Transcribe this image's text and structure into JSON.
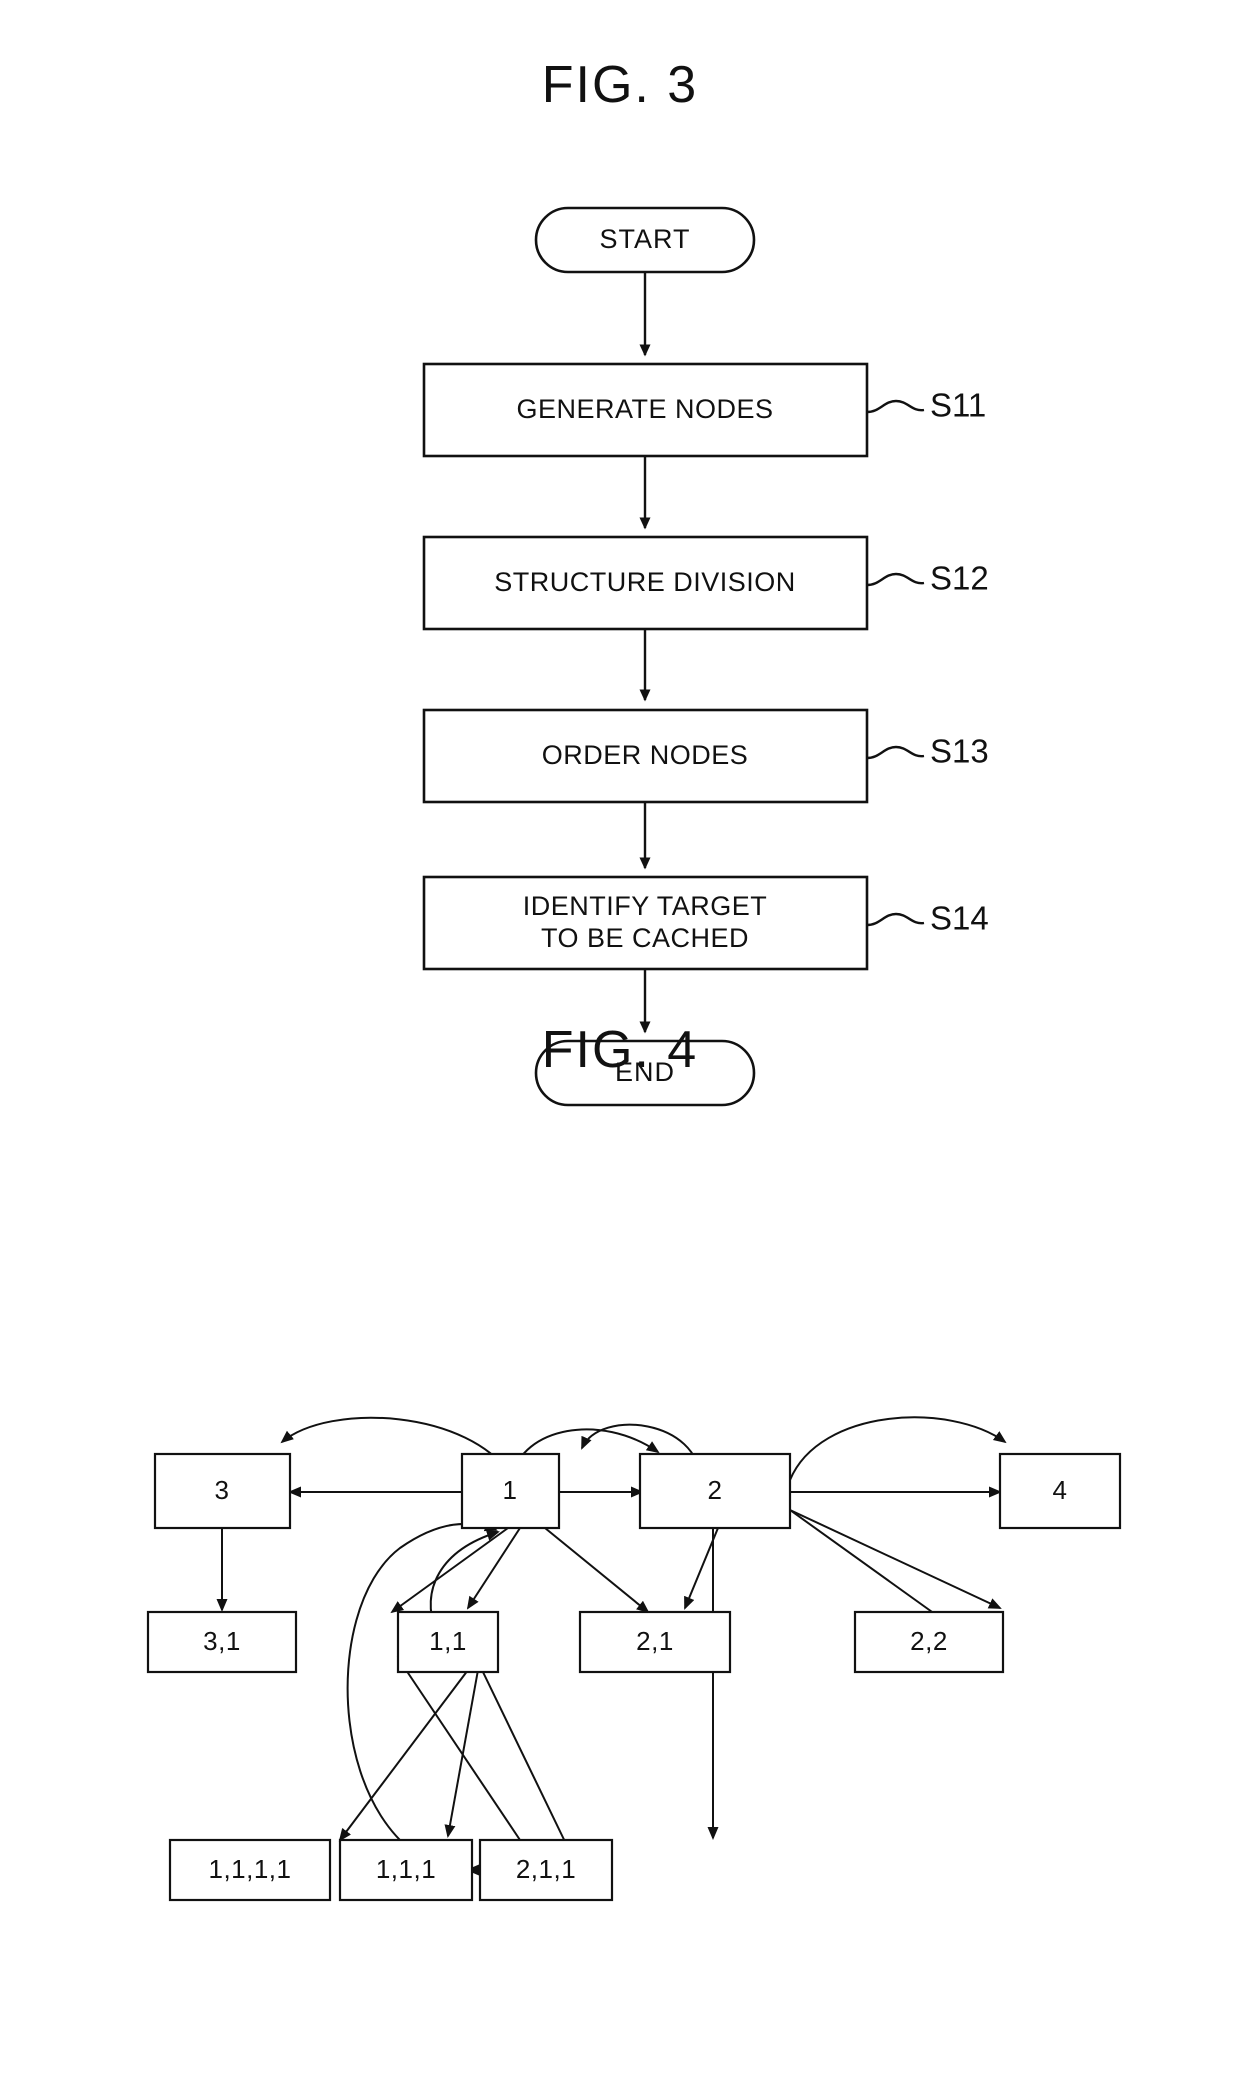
{
  "figures": [
    {
      "title": "FIG. 3",
      "type": "flowchart",
      "nodes": [
        {
          "id": "start",
          "shape": "terminal",
          "label": "START"
        },
        {
          "id": "s11",
          "shape": "process",
          "label": "GENERATE NODES",
          "step": "S11"
        },
        {
          "id": "s12",
          "shape": "process",
          "label": "STRUCTURE DIVISION",
          "step": "S12"
        },
        {
          "id": "s13",
          "shape": "process",
          "label": "ORDER NODES",
          "step": "S13"
        },
        {
          "id": "s14",
          "shape": "process",
          "label_line1": "IDENTIFY TARGET",
          "label_line2": "TO BE CACHED",
          "step": "S14"
        },
        {
          "id": "end",
          "shape": "terminal",
          "label": "END"
        }
      ]
    },
    {
      "title": "FIG. 4",
      "type": "node-graph",
      "nodes": [
        {
          "id": "n3",
          "label": "3"
        },
        {
          "id": "n1",
          "label": "1"
        },
        {
          "id": "n2",
          "label": "2"
        },
        {
          "id": "n4",
          "label": "4"
        },
        {
          "id": "n31",
          "label": "3,1"
        },
        {
          "id": "n11",
          "label": "1,1"
        },
        {
          "id": "n21",
          "label": "2,1"
        },
        {
          "id": "n22",
          "label": "2,2"
        },
        {
          "id": "n1111",
          "label": "1,1,1,1"
        },
        {
          "id": "n111",
          "label": "1,1,1"
        },
        {
          "id": "n211",
          "label": "2,1,1"
        }
      ],
      "edges": [
        {
          "from": "n1",
          "to": "n3",
          "style": "curve"
        },
        {
          "from": "n1",
          "to": "n3",
          "style": "straight"
        },
        {
          "from": "n1",
          "to": "n2",
          "style": "straight"
        },
        {
          "from": "n1",
          "to": "n2",
          "style": "curve"
        },
        {
          "from": "n2",
          "to": "n2",
          "style": "curve"
        },
        {
          "from": "n2",
          "to": "n4",
          "style": "straight"
        },
        {
          "from": "n2",
          "to": "n4",
          "style": "curve"
        },
        {
          "from": "n3",
          "to": "n31",
          "style": "straight"
        },
        {
          "from": "n1",
          "to": "n31",
          "style": "straight"
        },
        {
          "from": "n1",
          "to": "n11",
          "style": "straight"
        },
        {
          "from": "n1",
          "to": "n21",
          "style": "straight"
        },
        {
          "from": "n2",
          "to": "n21",
          "style": "straight"
        },
        {
          "from": "n2",
          "to": "n22",
          "style": "straight"
        },
        {
          "from": "n2",
          "to": "n211",
          "style": "straight"
        },
        {
          "from": "n11",
          "to": "n1111",
          "style": "straight"
        },
        {
          "from": "n11",
          "to": "n111",
          "style": "straight"
        },
        {
          "from": "n11",
          "to": "n211",
          "style": "straight"
        },
        {
          "from": "n111",
          "to": "n11",
          "style": "straight"
        },
        {
          "from": "n1111",
          "to": "n1",
          "style": "curve"
        },
        {
          "from": "n111",
          "to": "n1111",
          "style": "straight"
        }
      ]
    }
  ],
  "colors": {
    "stroke": "#111111",
    "fill": "#ffffff",
    "background": "#ffffff"
  }
}
